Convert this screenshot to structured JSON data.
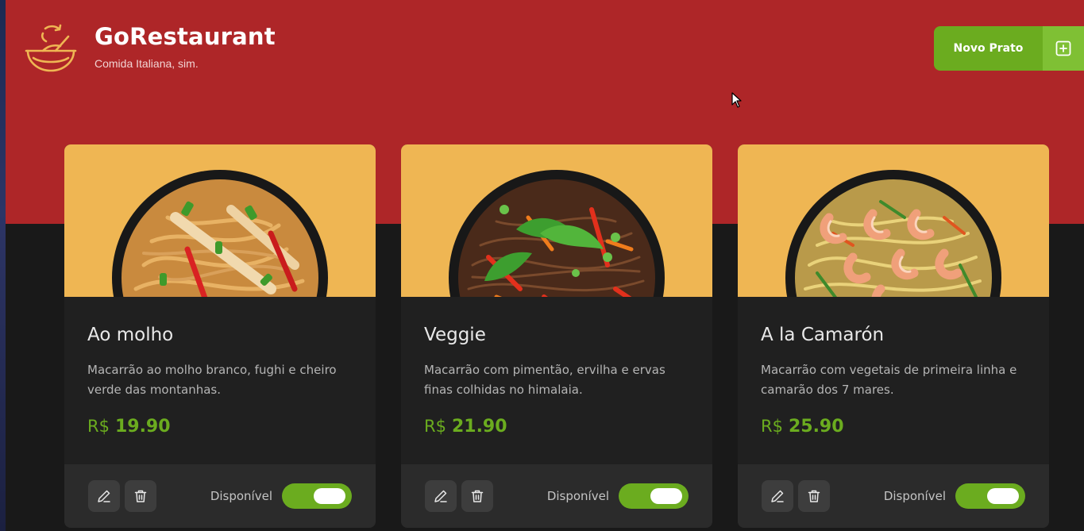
{
  "header": {
    "title": "GoRestaurant",
    "subtitle": "Comida Italiana, sim.",
    "new_button_label": "Novo Prato",
    "accent": "#ae2628",
    "button_color": "#6bac1f"
  },
  "icons": {
    "logo": "bowl-logo-icon",
    "add": "plus-square-icon",
    "edit": "pencil-icon",
    "delete": "trash-icon"
  },
  "dishes": [
    {
      "name": "Ao molho",
      "description": "Macarrão ao molho branco, fughi e cheiro verde das montanhas.",
      "currency": "R$",
      "price": "19.90",
      "available_label": "Disponível",
      "available": true
    },
    {
      "name": "Veggie",
      "description": "Macarrão com pimentão, ervilha e ervas finas colhidas no himalaia.",
      "currency": "R$",
      "price": "21.90",
      "available_label": "Disponível",
      "available": true
    },
    {
      "name": "A la Camarón",
      "description": "Macarrão com vegetais de primeira linha e camarão dos 7 mares.",
      "currency": "R$",
      "price": "25.90",
      "available_label": "Disponível",
      "available": true
    }
  ]
}
